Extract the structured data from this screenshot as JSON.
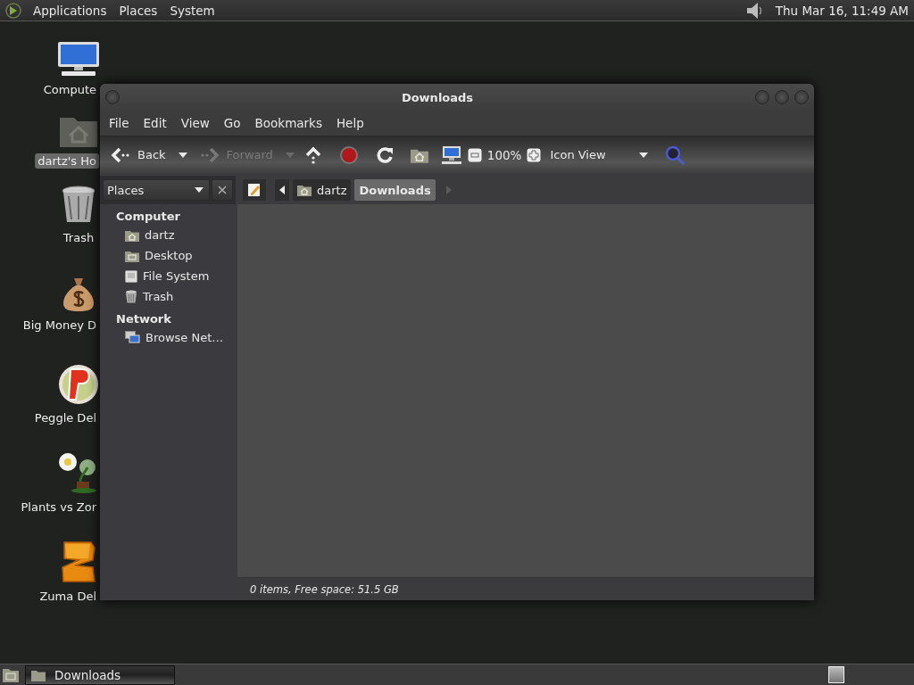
{
  "top_panel": {
    "menus": [
      "Applications",
      "Places",
      "System"
    ],
    "clock": "Thu Mar 16, 11:49 AM"
  },
  "desktop_icons": [
    {
      "label": "Compute",
      "kind": "computer",
      "selected": false
    },
    {
      "label": "dartz's Ho",
      "kind": "home",
      "selected": true
    },
    {
      "label": "Trash",
      "kind": "trash",
      "selected": false
    },
    {
      "label": "Big Money D",
      "kind": "moneybag",
      "selected": false
    },
    {
      "label": "Peggle Del",
      "kind": "ball",
      "selected": false
    },
    {
      "label": "Plants vs Zor",
      "kind": "plant",
      "selected": false
    },
    {
      "label": "Zuma Del",
      "kind": "block",
      "selected": false
    }
  ],
  "window": {
    "title": "Downloads",
    "menu": [
      "File",
      "Edit",
      "View",
      "Go",
      "Bookmarks",
      "Help"
    ],
    "toolbar": {
      "back": {
        "label": "Back",
        "disabled": false
      },
      "forward": {
        "label": "Forward",
        "disabled": true
      },
      "zoom": "100%",
      "view": "Icon View"
    },
    "sidebar": {
      "header": "Places",
      "sections": [
        {
          "title": "Computer",
          "items": [
            {
              "label": "dartz",
              "kind": "home"
            },
            {
              "label": "Desktop",
              "kind": "desktop"
            },
            {
              "label": "File System",
              "kind": "drive"
            },
            {
              "label": "Trash",
              "kind": "trash"
            }
          ]
        },
        {
          "title": "Network",
          "items": [
            {
              "label": "Browse Net…",
              "kind": "network"
            }
          ]
        }
      ]
    },
    "path": [
      {
        "label": "dartz",
        "kind": "home",
        "selected": false
      },
      {
        "label": "Downloads",
        "selected": true
      }
    ],
    "status": "0 items, Free space: 51.5 GB"
  },
  "taskbar": {
    "tasks": [
      {
        "label": "Downloads"
      }
    ]
  }
}
